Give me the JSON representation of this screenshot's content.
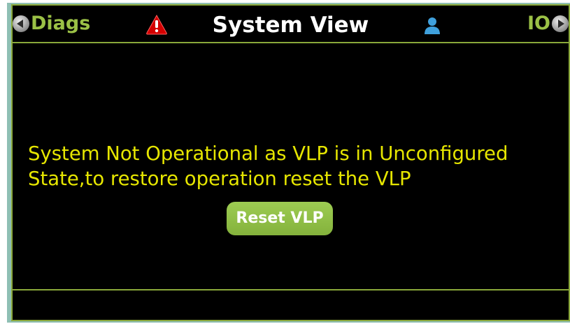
{
  "header": {
    "left_nav_label": "Diags",
    "title": "System View",
    "right_nav_label": "IO",
    "alarm_icon": "alarm-triangle-icon",
    "user_icon": "user-icon"
  },
  "main": {
    "message": "System Not Operational as VLP is in Unconfigured\nState,to restore operation reset the VLP",
    "reset_button_label": "Reset VLP"
  },
  "colors": {
    "background": "#000000",
    "border": "#8aa83a",
    "nav_text": "#9bc146",
    "message_text": "#e6e600",
    "button": "#92c046",
    "alarm": "#d40000",
    "user_icon": "#3fa0dc"
  }
}
